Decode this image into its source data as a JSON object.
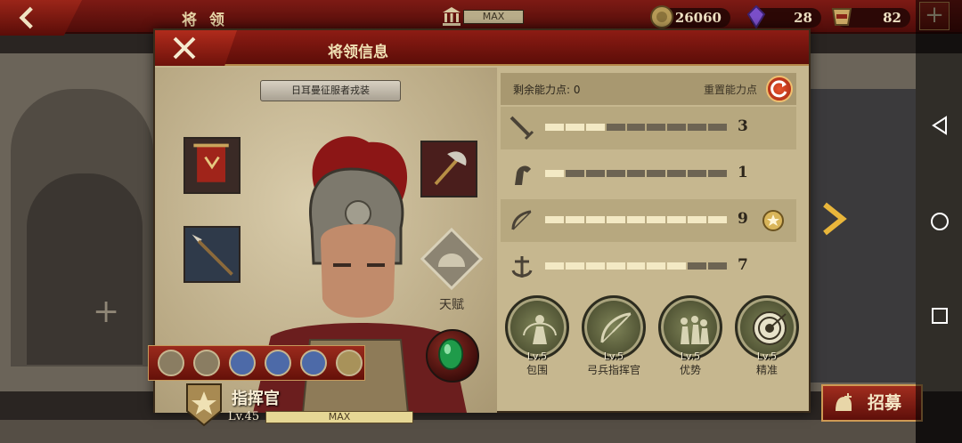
{
  "topbar": {
    "title": "将 领",
    "building_level": "MAX",
    "gold": "26060",
    "gems": "28",
    "tokens": "82",
    "plus_label": "+"
  },
  "background": {
    "plus_label": "+",
    "recruit_label": "招募"
  },
  "modal": {
    "title": "将领信息",
    "costume": "日耳曼征服者戎装",
    "talent_label": "天赋",
    "commander_title": "指挥官",
    "level": "Lv.45",
    "level_bar": "MAX",
    "points_label": "剩余能力点: 0",
    "reset_label": "重置能力点",
    "stats": [
      {
        "icon": "sword-icon",
        "value": "3",
        "filled": 3
      },
      {
        "icon": "horse-icon",
        "value": "1",
        "filled": 1
      },
      {
        "icon": "bow-icon",
        "value": "9",
        "filled": 9
      },
      {
        "icon": "anchor-icon",
        "value": "7",
        "filled": 7
      }
    ],
    "stat_max": 9,
    "perks": [
      {
        "level": "Lv.5",
        "name": "包围"
      },
      {
        "level": "Lv.5",
        "name": "弓兵指挥官"
      },
      {
        "level": "Lv.5",
        "name": "优势"
      },
      {
        "level": "Lv.5",
        "name": "精准"
      }
    ]
  },
  "colors": {
    "banner_red": "#7d1a14",
    "panel_tan": "#c6b78f",
    "gold_trim": "#cf9a54"
  }
}
